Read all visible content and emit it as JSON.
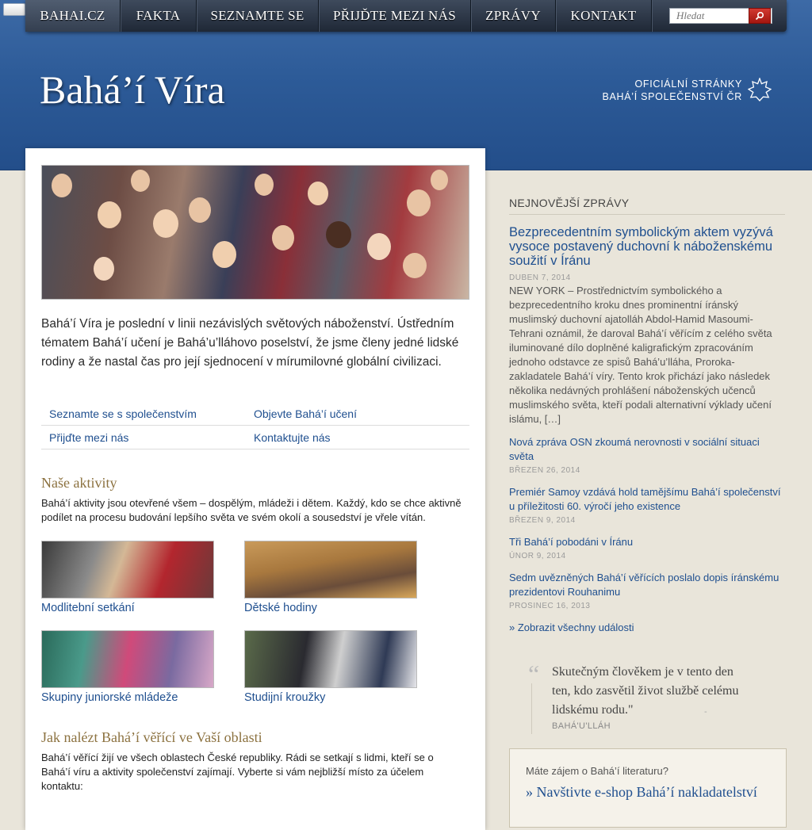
{
  "nav": {
    "items": [
      {
        "label": "BAHAI.CZ",
        "width": 120
      },
      {
        "label": "FAKTA",
        "width": 96
      },
      {
        "label": "SEZNAMTE SE",
        "width": 154
      },
      {
        "label": "PŘIJĎTE MEZI NÁS",
        "width": 192
      },
      {
        "label": "ZPRÁVY",
        "width": 107
      },
      {
        "label": "KONTAKT",
        "width": 120
      }
    ],
    "search_placeholder": "Hledat"
  },
  "header": {
    "title": "Bahá’í Víra",
    "tagline_line1": "OFICIÁLNÍ STRÁNKY",
    "tagline_line2": "BAHÁ’Í SPOLEČENSTVÍ ČR"
  },
  "main": {
    "intro": "Bahá’í Víra je poslední v linii nezávislých světových náboženství. Ústředním tématem Bahá’í učení je Bahá’u’lláhovo poselství, že jsme členy jedné lidské rodiny a že nastal čas pro její sjednocení v mírumilovné globální civilizaci.",
    "links": [
      [
        "Seznamte se s společenstvím",
        "Objevte Bahá’í učení"
      ],
      [
        "Přijďte mezi nás",
        "Kontaktujte nás"
      ]
    ],
    "activities_title": "Naše aktivity",
    "activities_text": "Bahá’í aktivity jsou otevřené všem – dospělým, mládeži i dětem. Každý, kdo se chce aktivně podílet na procesu budování lepšího světa ve svém okolí a sousedství je vřele vítán.",
    "activities": [
      "Modlitební setkání",
      "Dětské hodiny",
      "Skupiny juniorské mládeže",
      "Studijní kroužky"
    ],
    "find_title": "Jak nalézt Bahá’í věřící ve Vaší oblasti",
    "find_text": "Bahá’í věřící žijí ve všech oblastech České republiky. Rádi se setkají s lidmi, kteří se o Bahá’í víru a aktivity společenství zajímají. Vyberte si vám nejbližší místo za účelem kontaktu:"
  },
  "sidebar": {
    "news_title": "NEJNOVĚJŠÍ ZPRÁVY",
    "featured": {
      "title": "Bezprecedentním symbolickým aktem vyzývá vysoce postavený duchovní k náboženskému soužití v Íránu",
      "date": "DUBEN 7, 2014",
      "excerpt": "NEW YORK – Prostřednictvím symbolického a bezprecedentního kroku dnes prominentní íránský muslimský duchovní ajatolláh Abdol-Hamid Masoumi-Tehrani oznámil, že daroval Bahá’í věřícím z celého světa iluminované dílo doplněné kaligrafickým zpracováním jednoho odstavce ze spisů Bahá’u’lláha, Proroka-zakladatele Bahá’í víry. Tento krok přichází jako následek několika nedávných prohlášení náboženských učenců muslimského světa, kteří podali alternativní výklady učení islámu, […]"
    },
    "news": [
      {
        "title": "Nová zpráva OSN zkoumá nerovnosti v sociální situaci světa",
        "date": "BŘEZEN 26, 2014"
      },
      {
        "title": "Premiér Samoy vzdává hold tamějšímu Bahá’í společenství u příležitosti 60. výročí jeho existence",
        "date": "BŘEZEN 9, 2014"
      },
      {
        "title": "Tři Bahá’í pobodáni v Íránu",
        "date": "ÚNOR 9, 2014"
      },
      {
        "title": "Sedm uvězněných Bahá’í věřících poslalo dopis íránskému prezidentovi Rouhanimu",
        "date": "PROSINEC 16, 2013"
      }
    ],
    "all_events": "» Zobrazit všechny události",
    "quote": "Skutečným člověkem je v tento den ten, kdo zasvětil život službě celému lidskému rodu.\"",
    "quote_author": "BAHÁ'U'LLÁH",
    "promo_question": "Máte zájem o Bahá’í literaturu?",
    "promo_link": "» Navštivte e-shop Bahá’í nakladatelství"
  }
}
